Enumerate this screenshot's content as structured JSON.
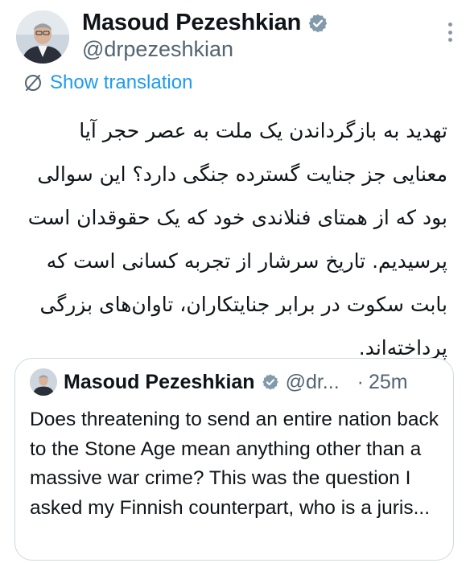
{
  "tweet": {
    "author_name": "Masoud Pezeshkian",
    "handle": "@drpezeshkian",
    "show_translation": "Show translation",
    "text": "تهدید به بازگرداندن یک ملت به عصر حجر آیا معنایی جز جنایت گسترده جنگی دارد؟ این سوالی بود که از همتای فنلاندی خود که یک حقوقدان است پرسیدیم. تاریخ سرشار از تجربه کسانی است که بابت سکوت در برابر جنایتکاران، تاوان‌های بزرگی پرداخته‌اند."
  },
  "quoted_tweet": {
    "author_name": "Masoud Pezeshkian",
    "handle": "@dr...",
    "separator": "·",
    "time": "25m",
    "text": "Does threatening to send an entire nation back to the Stone Age mean anything other than a massive war crime? This was the question I asked my Finnish counterpart, who is a juris..."
  },
  "icons": {
    "verified": "verified-badge-icon",
    "translate": "globe-translate-icon",
    "more": "more-options-icon"
  },
  "colors": {
    "link_blue": "#1d9bf0",
    "text": "#0f1419",
    "secondary_text": "#536471",
    "border": "#cfd9de"
  }
}
